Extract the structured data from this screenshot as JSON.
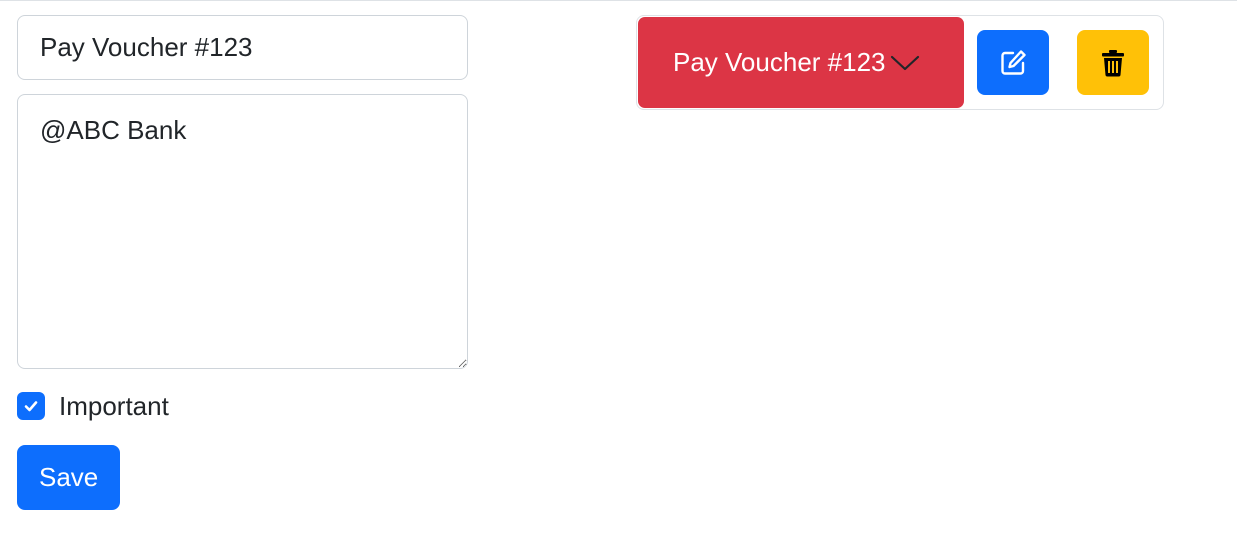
{
  "form": {
    "title_value": "Pay Voucher #123",
    "body_value": "@ABC Bank",
    "important_label": "Important",
    "important_checked": true,
    "save_label": "Save"
  },
  "note_card": {
    "title": "Pay Voucher #123",
    "toggle_icon": "chevron-down-icon",
    "edit_icon": "edit-icon",
    "delete_icon": "trash-icon"
  },
  "colors": {
    "primary": "#0d6efd",
    "danger": "#dc3545",
    "warning": "#ffc107",
    "border": "#ced4da",
    "text": "#212529"
  }
}
